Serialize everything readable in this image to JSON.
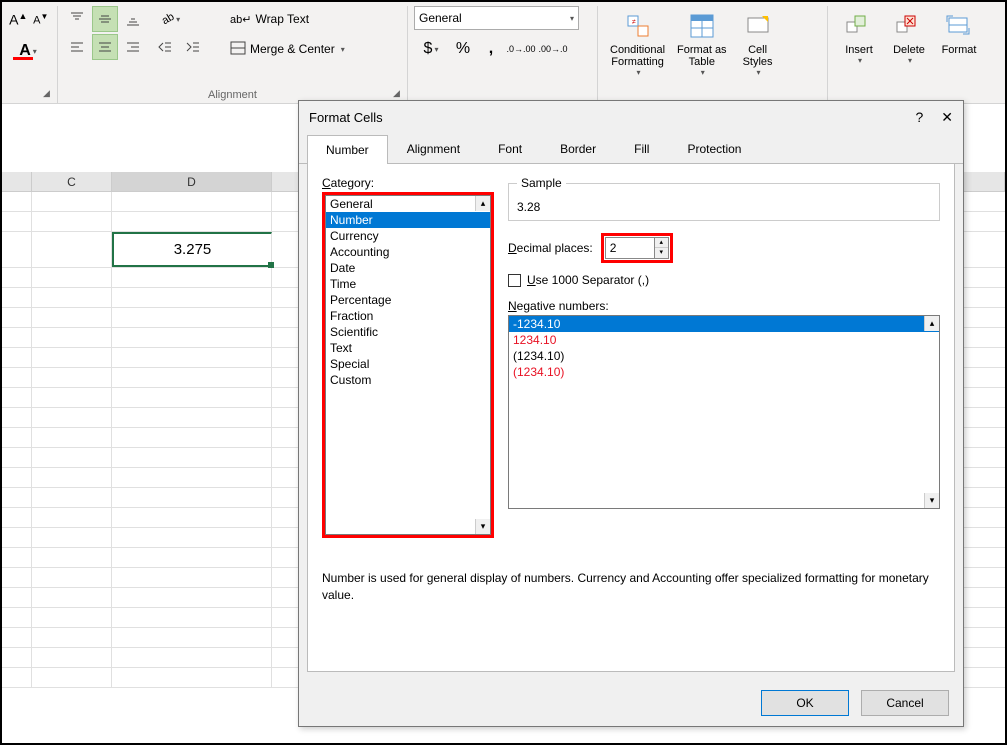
{
  "ribbon": {
    "wrap_text": "Wrap Text",
    "merge_center": "Merge & Center",
    "alignment_label": "Alignment",
    "number_format": "General",
    "cond_fmt": "Conditional\nFormatting",
    "fmt_table": "Format as\nTable",
    "cell_styles": "Cell\nStyles",
    "insert": "Insert",
    "delete": "Delete",
    "format": "Format"
  },
  "sheet": {
    "col_c": "C",
    "col_d": "D",
    "cell_value": "3.275"
  },
  "dialog": {
    "title": "Format Cells",
    "tabs": [
      "Number",
      "Alignment",
      "Font",
      "Border",
      "Fill",
      "Protection"
    ],
    "category_label": "Category:",
    "categories": [
      "General",
      "Number",
      "Currency",
      "Accounting",
      "Date",
      "Time",
      "Percentage",
      "Fraction",
      "Scientific",
      "Text",
      "Special",
      "Custom"
    ],
    "sample_label": "Sample",
    "sample_value": "3.28",
    "decimal_label": "Decimal places:",
    "decimal_value": "2",
    "use_sep": "Use 1000 Separator (,)",
    "neg_label": "Negative numbers:",
    "neg_items": [
      "-1234.10",
      "1234.10",
      "(1234.10)",
      "(1234.10)"
    ],
    "description": "Number is used for general display of numbers.  Currency and Accounting offer specialized formatting for monetary value.",
    "ok": "OK",
    "cancel": "Cancel"
  }
}
